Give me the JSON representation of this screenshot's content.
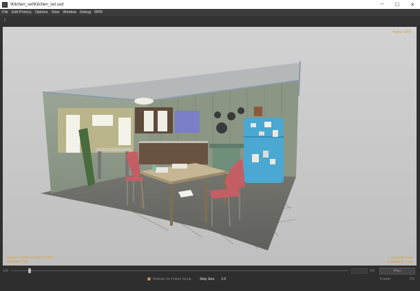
{
  "window": {
    "title": "\\Kitchen_set\\Kitchen_set.usd",
    "minimize_glyph": "─",
    "maximize_glyph": "☐",
    "close_glyph": "✕"
  },
  "menu": {
    "items": [
      "File",
      "Edit Prim(s)",
      "Options",
      "View",
      "Window",
      "Debug",
      "RPR"
    ]
  },
  "path": {
    "current": "/"
  },
  "viewport": {
    "renderer_label": "Hydra: RPR",
    "render_stats": "Render: 54.00 ms (18.52 FPS)",
    "playback": "Playback: N/A",
    "camera": "Camera: Free",
    "complexity": "Complexity: Low"
  },
  "timeline": {
    "start_value": "0.0",
    "end_value": "0.0",
    "current_fraction": 0.05,
    "play_label": "Play"
  },
  "controls": {
    "redraw_label": "Redraw On Frame Scrub",
    "redraw_checked": true,
    "step_size_label": "Step Size",
    "step_size_value": "1.0",
    "frames_label": "Frame:",
    "frames_value": "0.0"
  },
  "colors": {
    "hud_text": "#d8a23a",
    "menubar": "#3c3c3c",
    "viewport_bg": "#c5c5c5"
  }
}
